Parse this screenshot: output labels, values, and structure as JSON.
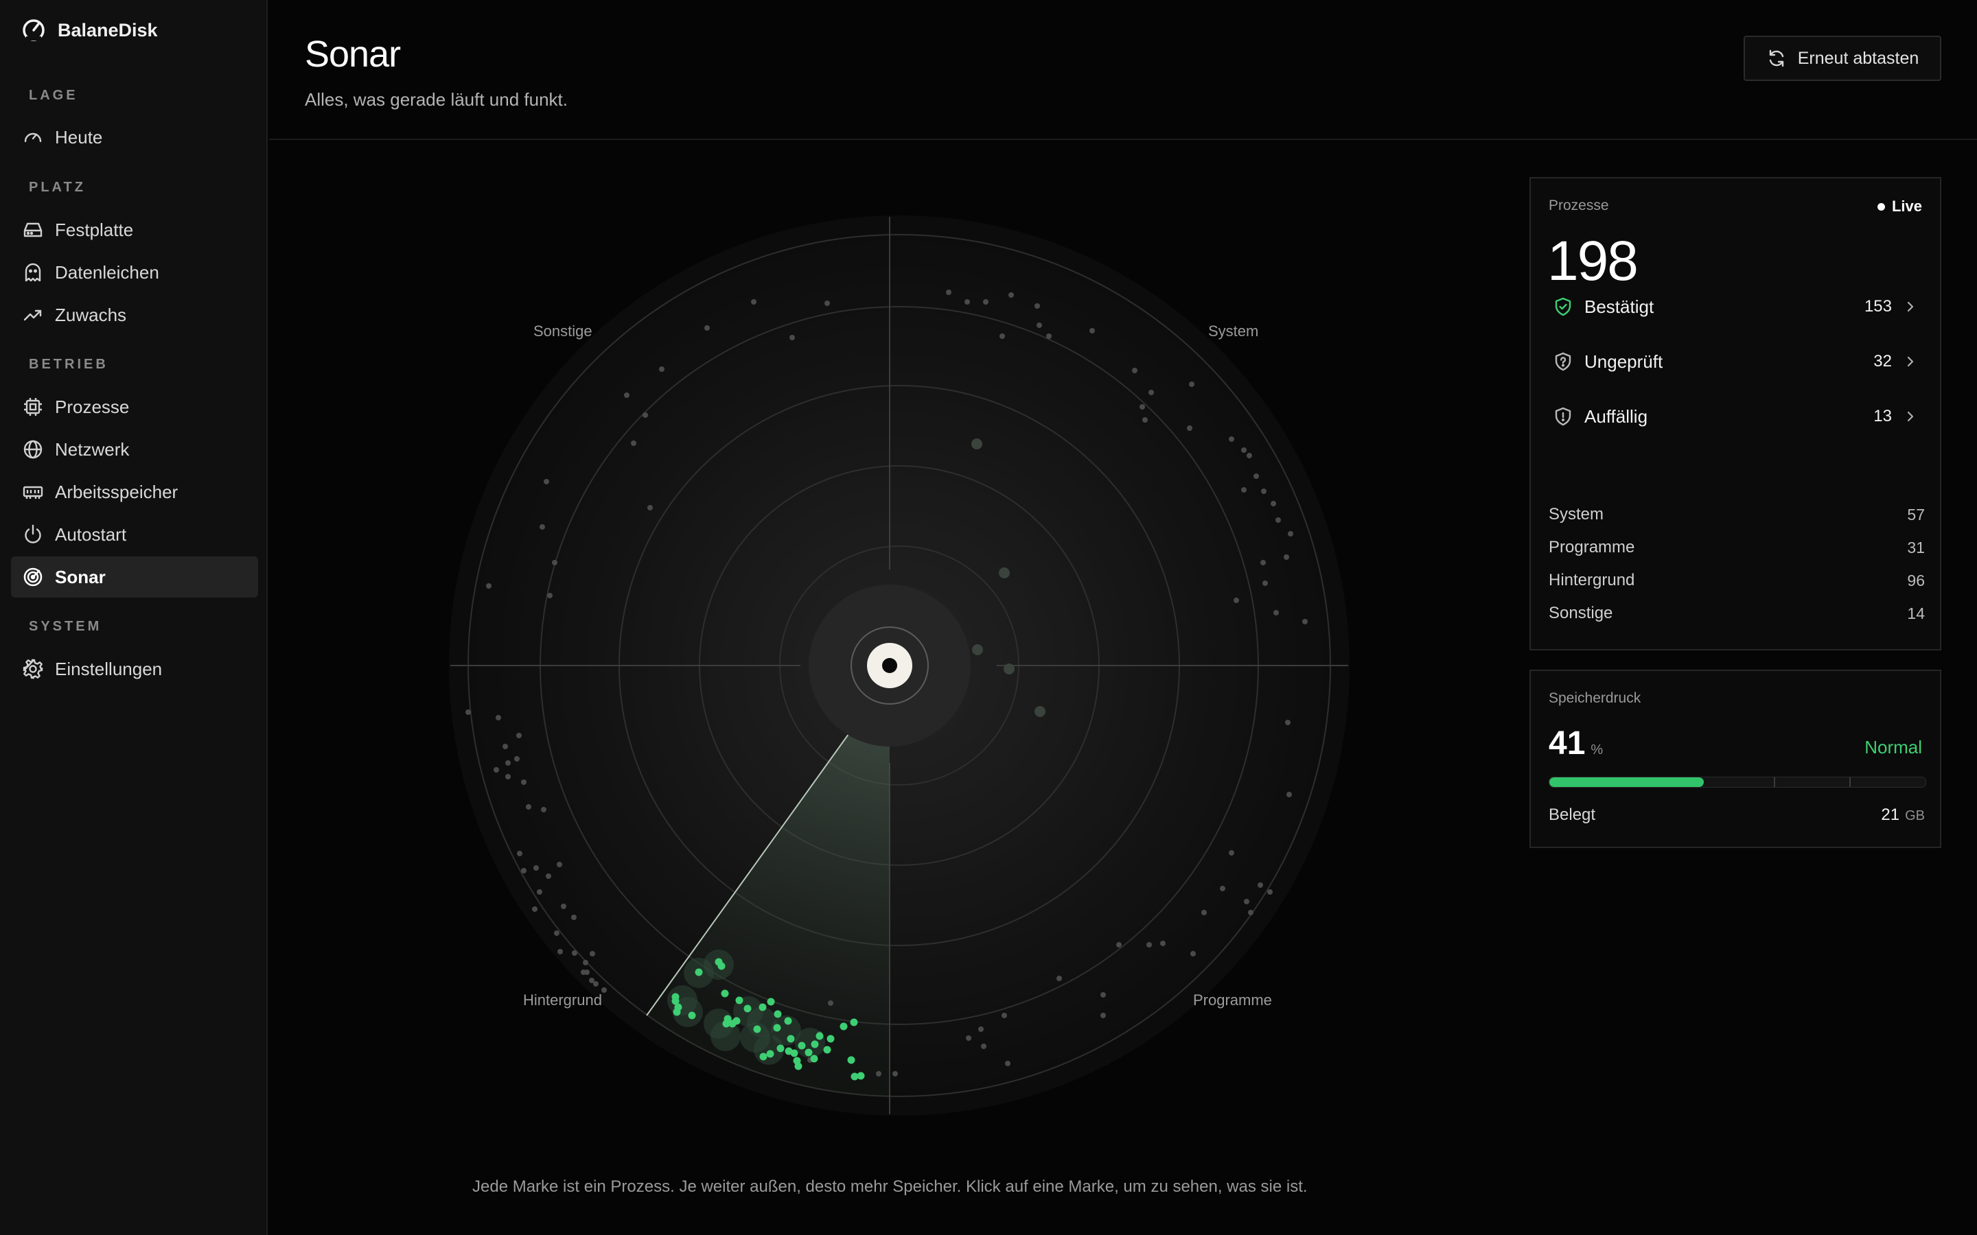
{
  "app": {
    "name": "BalaneDisk"
  },
  "sidebar": {
    "sections": [
      {
        "label": "LAGE",
        "items": [
          {
            "label": "Heute",
            "icon": "gauge-icon"
          }
        ]
      },
      {
        "label": "PLATZ",
        "items": [
          {
            "label": "Festplatte",
            "icon": "hard-drive-icon"
          },
          {
            "label": "Datenleichen",
            "icon": "ghost-icon"
          },
          {
            "label": "Zuwachs",
            "icon": "trending-up-icon"
          }
        ]
      },
      {
        "label": "BETRIEB",
        "items": [
          {
            "label": "Prozesse",
            "icon": "cpu-icon"
          },
          {
            "label": "Netzwerk",
            "icon": "globe-icon"
          },
          {
            "label": "Arbeitsspeicher",
            "icon": "memory-icon"
          },
          {
            "label": "Autostart",
            "icon": "power-icon"
          },
          {
            "label": "Sonar",
            "icon": "radar-icon",
            "active": true
          }
        ]
      },
      {
        "label": "SYSTEM",
        "items": [
          {
            "label": "Einstellungen",
            "icon": "gear-icon"
          }
        ]
      }
    ]
  },
  "header": {
    "title": "Sonar",
    "subtitle": "Alles, was gerade läuft und funkt.",
    "rescan_label": "Erneut abtasten"
  },
  "radar": {
    "quadrants": {
      "top_left": "Sonstige",
      "top_right": "System",
      "bottom_left": "Hintergrund",
      "bottom_right": "Programme"
    },
    "caption": "Jede Marke ist ein Prozess. Je weiter außen, desto mehr Speicher. Klick auf eine Marke, um zu sehen, was sie ist.",
    "accent_color": "#3ecf73"
  },
  "processes": {
    "title": "Prozesse",
    "live_label": "Live",
    "total": "198",
    "statuses": [
      {
        "label": "Bestätigt",
        "count": "153",
        "icon": "shield-check-icon",
        "color": "#3ecf73"
      },
      {
        "label": "Ungeprüft",
        "count": "32",
        "icon": "shield-question-icon",
        "color": "#b9b9b9"
      },
      {
        "label": "Auffällig",
        "count": "13",
        "icon": "shield-alert-icon",
        "color": "#b9b9b9"
      }
    ],
    "categories": [
      {
        "label": "System",
        "count": "57"
      },
      {
        "label": "Programme",
        "count": "31"
      },
      {
        "label": "Hintergrund",
        "count": "96"
      },
      {
        "label": "Sonstige",
        "count": "14"
      }
    ]
  },
  "memory": {
    "title": "Speicherdruck",
    "value": "41",
    "unit": "%",
    "state": "Normal",
    "percent": 41,
    "used_label": "Belegt",
    "used_value": "21",
    "used_unit": "GB"
  }
}
